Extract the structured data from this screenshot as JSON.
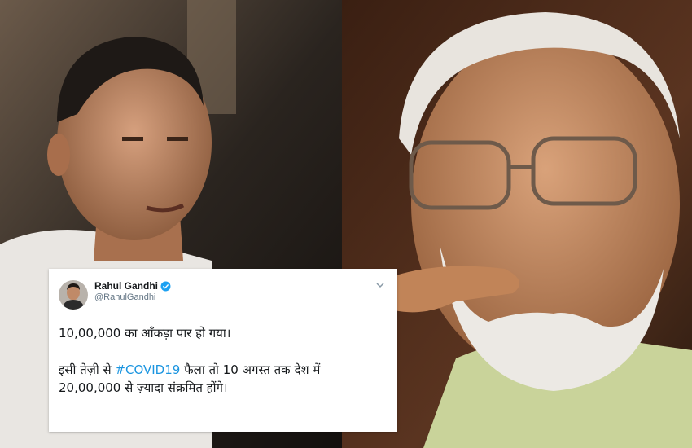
{
  "tweet": {
    "display_name": "Rahul Gandhi",
    "handle": "@RahulGandhi",
    "line1": "10,00,000 का आँकड़ा पार हो गया।",
    "line2_before": "इसी तेज़ी से ",
    "hashtag": "#COVID19",
    "line2_after": " फैला तो 10 अगस्त तक देश में",
    "line3": "20,00,000 से ज़्यादा संक्रमित होंगे।",
    "verified_icon": "verified-badge-icon",
    "menu_icon": "chevron-down-icon"
  },
  "colors": {
    "link": "#1b95e0",
    "text": "#14171a",
    "muted": "#657786",
    "verified": "#1da1f2"
  }
}
